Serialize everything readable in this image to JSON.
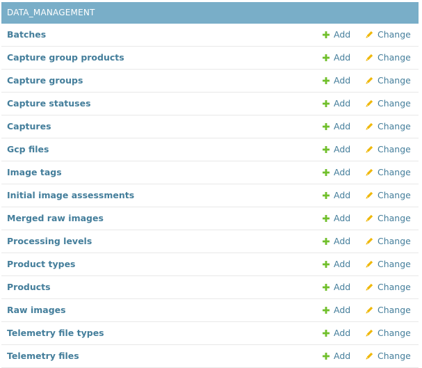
{
  "module": {
    "caption": "DATA_MANAGEMENT",
    "add_label": "Add",
    "change_label": "Change",
    "colors": {
      "caption_bg": "#79aec8",
      "link": "#447e9b",
      "add_icon": "#70bf2b",
      "change_icon": "#efb80b"
    },
    "models": [
      {
        "name": "Batches"
      },
      {
        "name": "Capture group products"
      },
      {
        "name": "Capture groups"
      },
      {
        "name": "Capture statuses"
      },
      {
        "name": "Captures"
      },
      {
        "name": "Gcp files"
      },
      {
        "name": "Image tags"
      },
      {
        "name": "Initial image assessments"
      },
      {
        "name": "Merged raw images"
      },
      {
        "name": "Processing levels"
      },
      {
        "name": "Product types"
      },
      {
        "name": "Products"
      },
      {
        "name": "Raw images"
      },
      {
        "name": "Telemetry file types"
      },
      {
        "name": "Telemetry files"
      }
    ]
  }
}
